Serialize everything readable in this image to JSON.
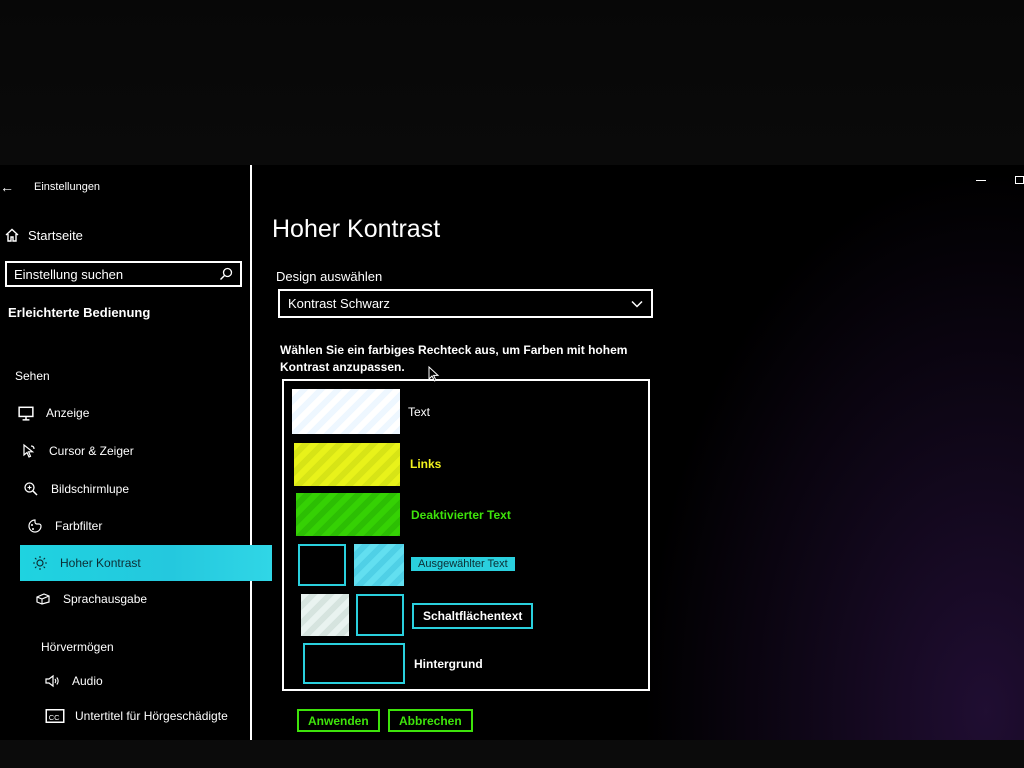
{
  "window": {
    "title": "Einstellungen"
  },
  "sidebar": {
    "home_label": "Startseite",
    "search": {
      "placeholder": "Einstellung suchen",
      "value": ""
    },
    "section_title": "Erleichterte Bedienung",
    "groups": [
      {
        "label": "Sehen"
      },
      {
        "label": "Hörvermögen"
      }
    ],
    "items": [
      {
        "label": "Anzeige",
        "icon": "display-icon"
      },
      {
        "label": "Cursor & Zeiger",
        "icon": "cursor-pointer-icon"
      },
      {
        "label": "Bildschirmlupe",
        "icon": "magnifier-icon"
      },
      {
        "label": "Farbfilter",
        "icon": "color-filter-icon"
      },
      {
        "label": "Hoher Kontrast",
        "icon": "high-contrast-icon",
        "active": true
      },
      {
        "label": "Sprachausgabe",
        "icon": "narrator-icon"
      },
      {
        "label": "Audio",
        "icon": "audio-icon"
      },
      {
        "label": "Untertitel für Hörgeschädigte",
        "icon": "closed-captions-icon"
      }
    ]
  },
  "main": {
    "title": "Hoher Kontrast",
    "theme_label": "Design auswählen",
    "theme_value": "Kontrast Schwarz",
    "instructions": "Wählen Sie ein farbiges Rechteck aus, um Farben mit hohem Kontrast anzupassen.",
    "swatches": {
      "text_label": "Text",
      "links_label": "Links",
      "disabled_label": "Deaktivierter Text",
      "selected_label": "Ausgewählter Text",
      "button_label": "Schaltflächentext",
      "background_label": "Hintergrund"
    },
    "apply_label": "Anwenden",
    "cancel_label": "Abbrechen"
  },
  "colors": {
    "text": "#ffffff",
    "links": "#f2f21e",
    "disabled_text": "#3ee30b",
    "selected_text_bg": "#2ad0de",
    "button_border": "#2ad0de",
    "background": "#000000",
    "active_nav": "#24c8de"
  }
}
